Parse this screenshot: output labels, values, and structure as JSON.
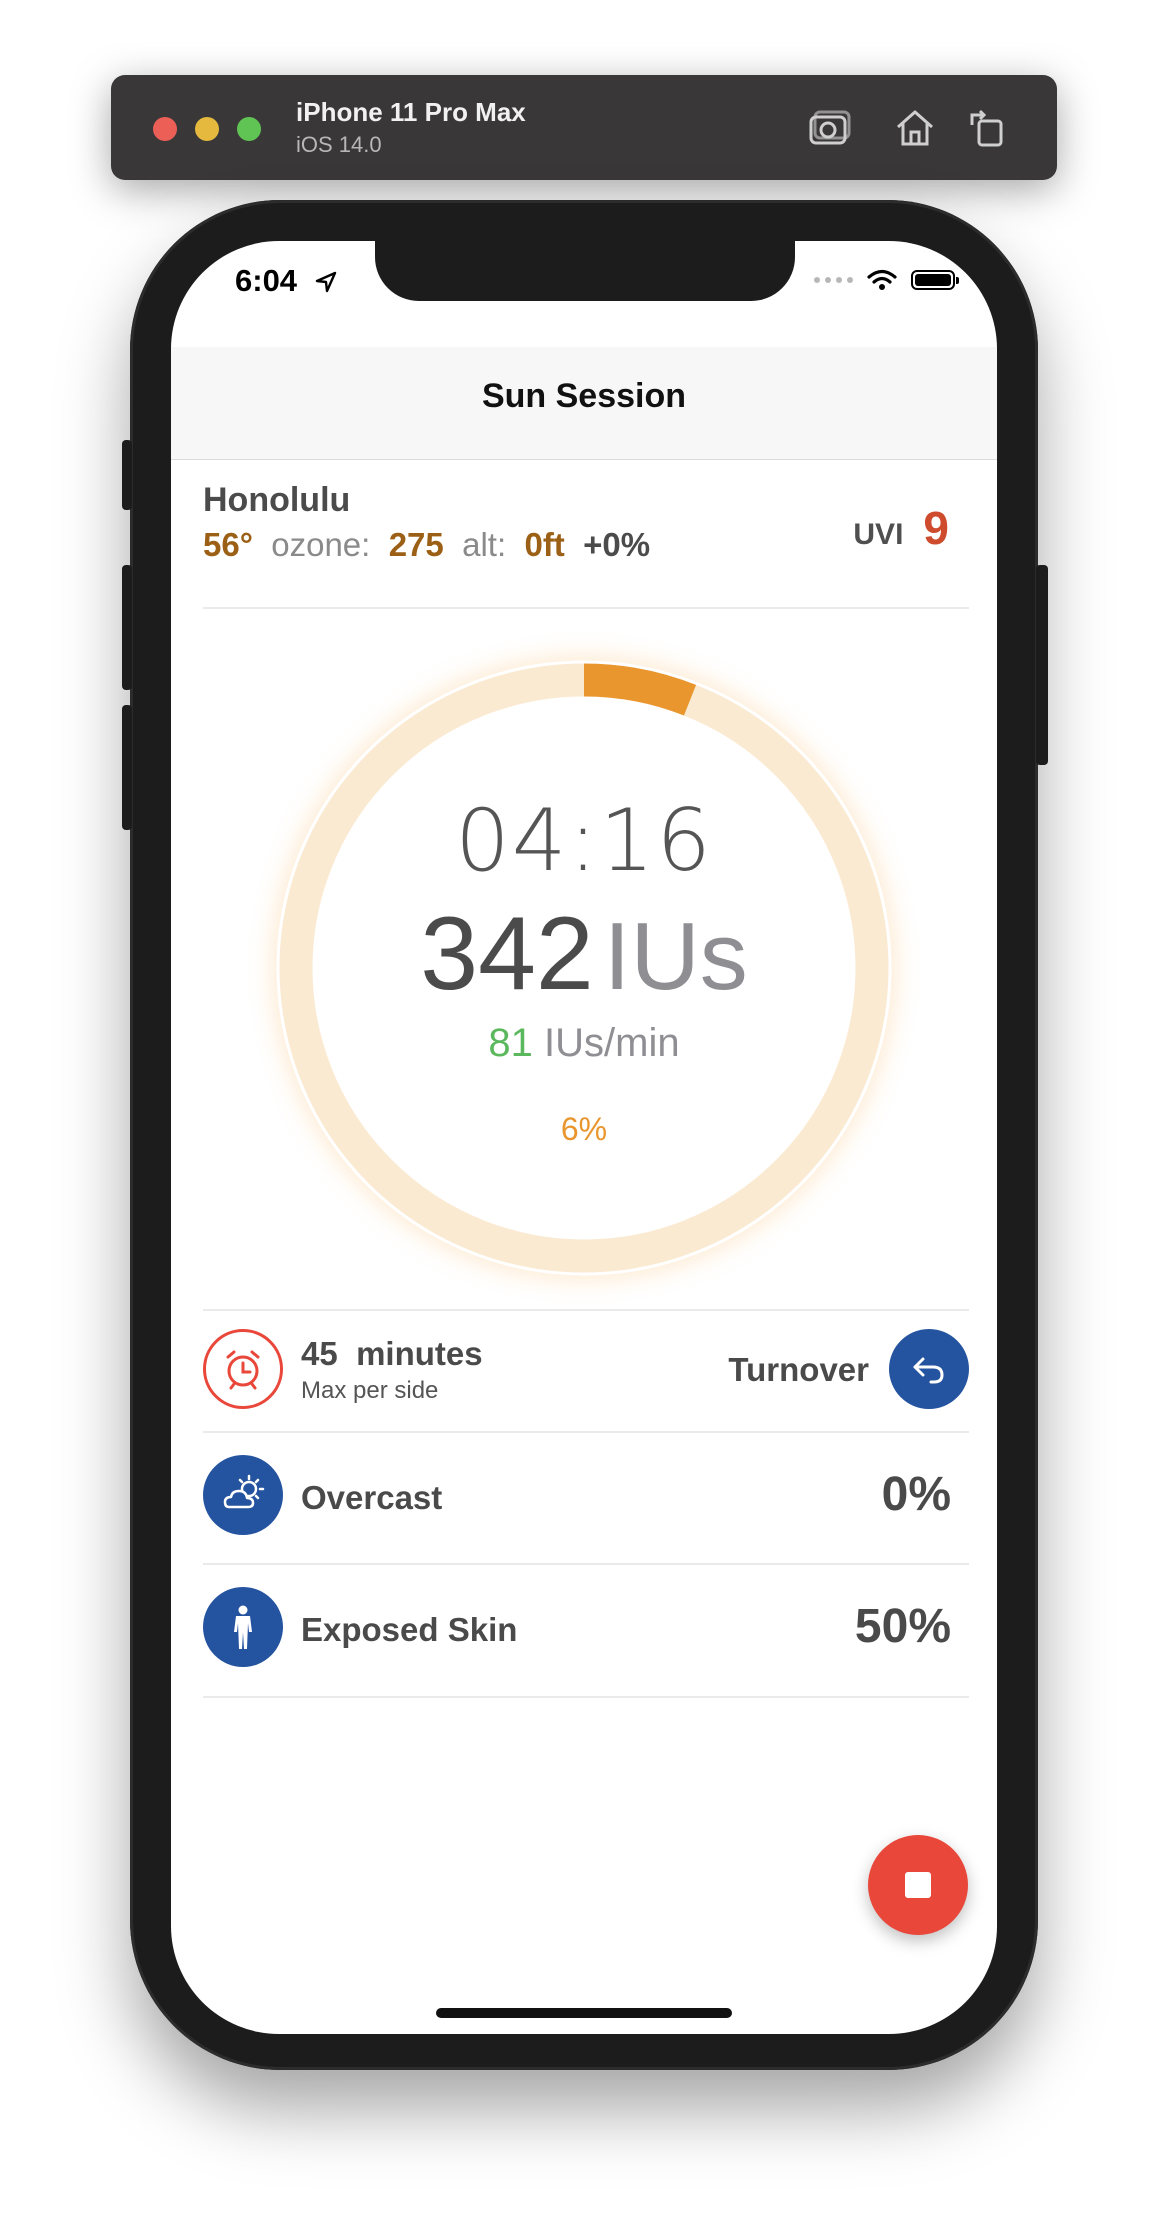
{
  "simulator": {
    "device_name": "iPhone 11 Pro Max",
    "os_version": "iOS 14.0"
  },
  "status_bar": {
    "time": "6:04"
  },
  "navbar": {
    "title": "Sun Session"
  },
  "location": {
    "city": "Honolulu",
    "temperature": "56°",
    "ozone_label": "ozone:",
    "ozone_value": "275",
    "alt_label": "alt:",
    "alt_value": "0ft",
    "alt_adjust": "+0%",
    "uvi_label": "UVI",
    "uvi_value": "9"
  },
  "session": {
    "timer": "04:16",
    "ius_value": "342",
    "ius_unit": "IUs",
    "rate_value": "81",
    "rate_unit": "IUs/min",
    "progress_label": "6%",
    "progress_fraction": 0.06
  },
  "rows": {
    "max_side": {
      "value": "45",
      "unit": "minutes",
      "subtitle": "Max per side",
      "turnover_label": "Turnover"
    },
    "overcast": {
      "label": "Overcast",
      "value": "0%"
    },
    "exposed_skin": {
      "label": "Exposed Skin",
      "value": "50%"
    }
  },
  "icons": {
    "alarm": "alarm-clock-icon",
    "turnover": "turnover-arrow-icon",
    "overcast": "partly-cloudy-icon",
    "skin": "human-body-icon",
    "stop": "stop-icon"
  },
  "colors": {
    "accent_orange": "#ea962f",
    "ring_track": "#fbead2",
    "brand_blue": "#24539f",
    "alert_red": "#e8473a",
    "rate_green": "#5cb85c",
    "value_brown": "#9b6016"
  }
}
